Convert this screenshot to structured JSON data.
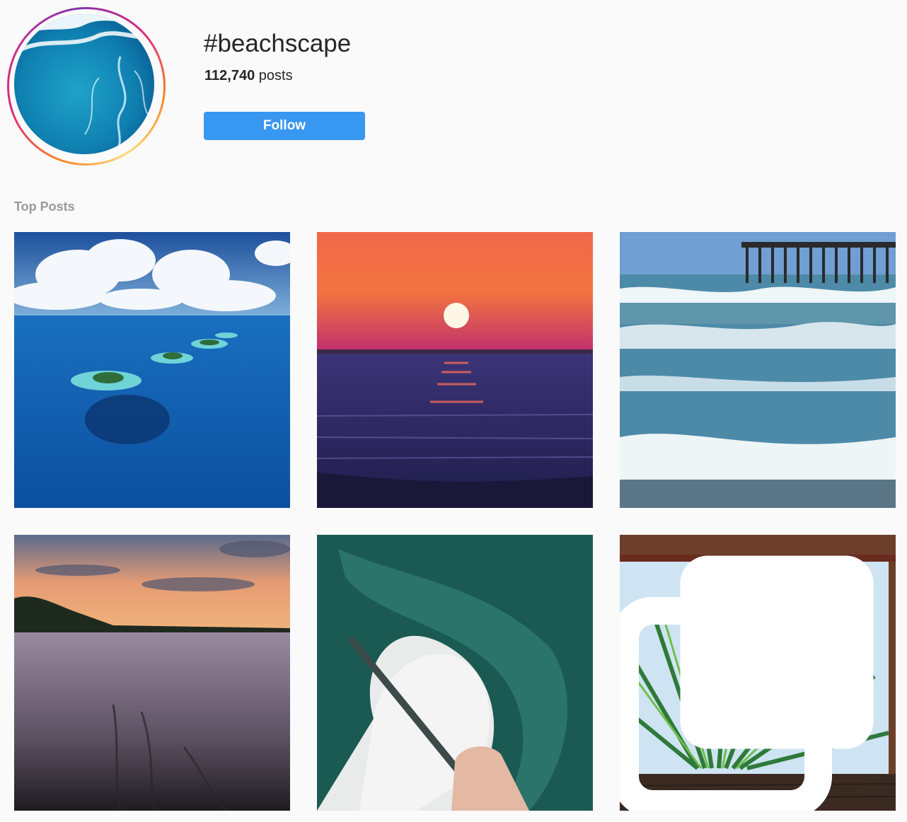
{
  "header": {
    "hashtag": "#beachscape",
    "post_count": "112,740",
    "post_count_suffix": " posts",
    "follow_label": "Follow"
  },
  "sections": {
    "top_posts_label": "Top Posts"
  },
  "posts": [
    {
      "subject": "aerial tropical islands in blue ocean"
    },
    {
      "subject": "sunset over sea"
    },
    {
      "subject": "waves and pier"
    },
    {
      "subject": "beach at sunset with reflections"
    },
    {
      "subject": "painting of wave with brush in hand"
    },
    {
      "subject": "painting of palm fronds",
      "badge": "multiple-posts-icon"
    }
  ],
  "colors": {
    "follow_button": "#3897f0",
    "background": "#fafafa",
    "section_label": "#999999"
  }
}
